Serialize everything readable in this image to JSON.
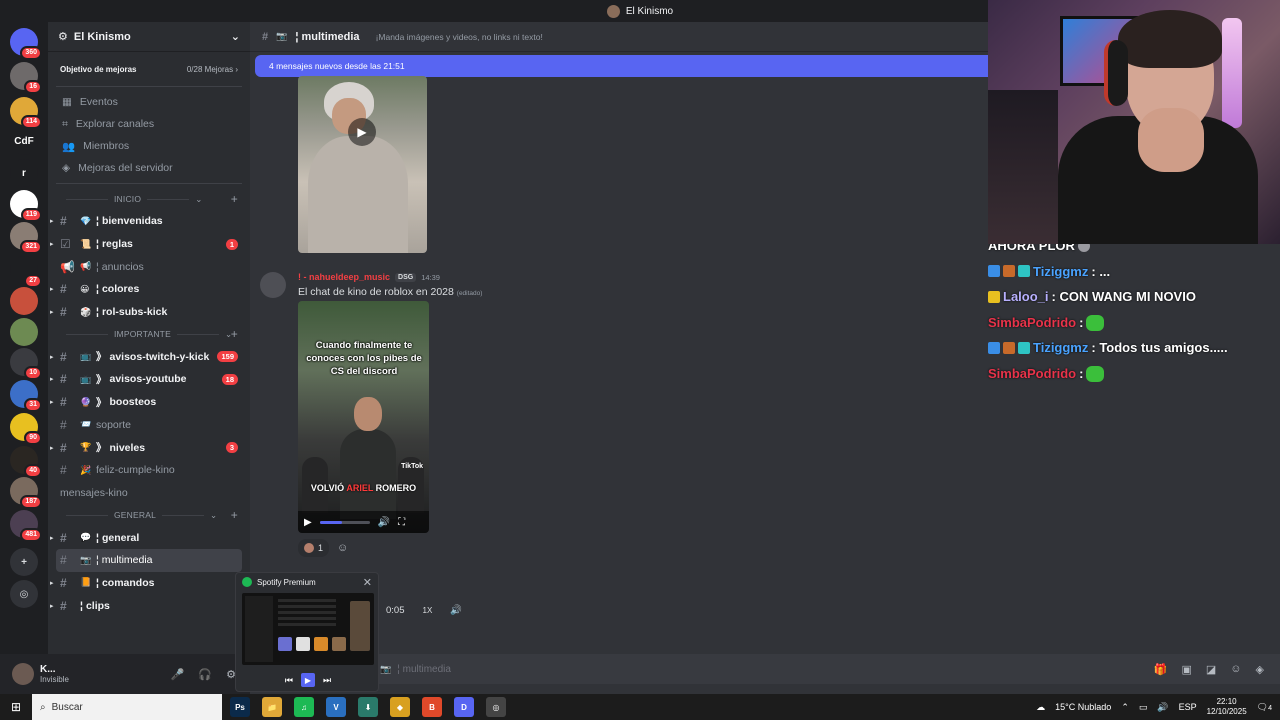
{
  "window": {
    "title": "El Kinismo"
  },
  "rail": {
    "servers": [
      {
        "label": "",
        "badge": "360",
        "color": "#5865f2"
      },
      {
        "label": "",
        "badge": "16",
        "color": "#6e6a6a"
      },
      {
        "label": "",
        "badge": "114",
        "color": "#e0a838"
      },
      {
        "label": "CdF",
        "badge": "",
        "color": "#1e1f22"
      },
      {
        "label": "r",
        "badge": "",
        "color": "#1e1f22"
      },
      {
        "label": "",
        "badge": "119",
        "color": "#ffffff"
      },
      {
        "label": "",
        "badge": "321",
        "color": "#8a7d74"
      },
      {
        "label": "",
        "badge": "27",
        "color": "#1e1f22"
      },
      {
        "label": "",
        "badge": "",
        "color": "#c8503c"
      },
      {
        "label": "",
        "badge": "",
        "color": "#6d8a52"
      },
      {
        "label": "",
        "badge": "10",
        "color": "#3a3b40"
      },
      {
        "label": "",
        "badge": "31",
        "color": "#3c6fc8"
      },
      {
        "label": "",
        "badge": "90",
        "color": "#e8c020"
      },
      {
        "label": "",
        "badge": "40",
        "color": "#2a2622"
      },
      {
        "label": "",
        "badge": "187",
        "color": "#7a6a5e"
      },
      {
        "label": "",
        "badge": "481",
        "color": "#4c3f52"
      }
    ]
  },
  "sidebar": {
    "server_name": "El Kinismo",
    "boost_goal_label": "Objetivo de mejoras",
    "boost_goal_value": "0/28 Mejoras",
    "nav": [
      {
        "label": "Eventos"
      },
      {
        "label": "Explorar canales"
      },
      {
        "label": "Miembros"
      },
      {
        "label": "Mejoras del servidor"
      }
    ],
    "categories": [
      {
        "name": "INICIO",
        "channels": [
          {
            "name": "bienvenidas",
            "emoji": "💎",
            "sep": "¦",
            "unread": true,
            "count": "",
            "symbol": "#"
          },
          {
            "name": "reglas",
            "emoji": "📜",
            "sep": "¦",
            "unread": true,
            "count": "1",
            "symbol": "☑"
          },
          {
            "name": "anuncios",
            "emoji": "📢",
            "sep": "¦",
            "unread": false,
            "count": "",
            "symbol": "📢"
          },
          {
            "name": "colores",
            "emoji": "😀",
            "sep": "¦",
            "unread": true,
            "count": "",
            "symbol": "#"
          },
          {
            "name": "rol-subs-kick",
            "emoji": "🎲",
            "sep": "¦",
            "unread": true,
            "count": "",
            "symbol": "#"
          }
        ]
      },
      {
        "name": "IMPORTANTE",
        "channels": [
          {
            "name": "avisos-twitch-y-kick",
            "emoji": "📺",
            "sep": "》",
            "unread": true,
            "count": "159",
            "symbol": "#"
          },
          {
            "name": "avisos-youtube",
            "emoji": "📺",
            "sep": "》",
            "unread": true,
            "count": "18",
            "symbol": "#"
          },
          {
            "name": "boosteos",
            "emoji": "🔮",
            "sep": "》",
            "unread": true,
            "count": "",
            "symbol": "#"
          },
          {
            "name": "soporte",
            "emoji": "📨",
            "sep": "",
            "unread": false,
            "count": "",
            "symbol": "#"
          },
          {
            "name": "niveles",
            "emoji": "🏆",
            "sep": "》",
            "unread": true,
            "count": "3",
            "symbol": "#"
          },
          {
            "name": "feliz-cumple-kino",
            "emoji": "🎉",
            "sep": "",
            "unread": false,
            "count": "",
            "symbol": "#"
          },
          {
            "name": "mensajes-kino",
            "emoji": "",
            "sep": "",
            "unread": false,
            "count": "",
            "symbol": ""
          }
        ]
      },
      {
        "name": "GENERAL",
        "channels": [
          {
            "name": "general",
            "emoji": "💬",
            "sep": "¦",
            "unread": true,
            "count": "",
            "symbol": "#"
          },
          {
            "name": "multimedia",
            "emoji": "📷",
            "sep": "¦",
            "unread": false,
            "count": "",
            "symbol": "#",
            "active": true
          },
          {
            "name": "comandos",
            "emoji": "📙",
            "sep": "¦",
            "unread": true,
            "count": "",
            "symbol": "#"
          },
          {
            "name": "clips",
            "emoji": "",
            "sep": "¦",
            "unread": true,
            "count": "",
            "symbol": "#"
          }
        ]
      }
    ]
  },
  "user": {
    "name": "K...",
    "status": "Invisible"
  },
  "chat": {
    "channel": "multimedia",
    "topic": "¡Manda imágenes y videos, no links ni texto!",
    "new_messages_banner": "4 mensajes nuevos desde las 21:51",
    "message": {
      "author": "! - nahueldeep_music",
      "tag": "DSG",
      "time": "14:39",
      "text": "El chat de kino de roblox en 2028",
      "edited": "(editado)"
    },
    "video_caption": "Cuando finalmente te conoces con los pibes de CS del discord",
    "video_bottom_pre": "VOLVIÓ ",
    "video_bottom_hl": "ARIEL",
    "video_bottom_post": " ROMERO",
    "video_watermark": "TikTok",
    "video_progress": 0.45,
    "reaction_count": "1",
    "audio_time": "0:05",
    "audio_speed": "1X",
    "composer_placeholder": "multimedia"
  },
  "spotify": {
    "title": "Spotify Premium"
  },
  "stream_chat": [
    {
      "user": "AHORA PLOR",
      "text": "",
      "color": "#ffffff",
      "badges": []
    },
    {
      "user": "Tiziggmz",
      "text": ": ...",
      "color": "#4aa3ff",
      "badges": [
        "#3a8ee6",
        "#c86a2a",
        "#2ec4c4"
      ]
    },
    {
      "user": "Laloo_i",
      "text": ": CON WANG MI NOVIO",
      "color": "#b8b0ff",
      "badges": [
        "#e8c020"
      ]
    },
    {
      "user": "SimbaPodrido",
      "text": ":",
      "color": "#e8334a",
      "badges": []
    },
    {
      "user": "Tiziggmz",
      "text": ": Todos tus amigos.....",
      "color": "#4aa3ff",
      "badges": [
        "#3a8ee6",
        "#c86a2a",
        "#2ec4c4"
      ]
    },
    {
      "user": "SimbaPodrido",
      "text": ":",
      "color": "#e8334a",
      "badges": []
    }
  ],
  "taskbar": {
    "search_placeholder": "Buscar",
    "weather": "15°C  Nublado",
    "lang": "ESP",
    "time": "22:10",
    "date": "12/10/2025",
    "notifications": "4",
    "apps": [
      {
        "label": "Ps",
        "color": "#0b2a4a"
      },
      {
        "label": "📁",
        "color": "#e0a838"
      },
      {
        "label": "♫",
        "color": "#1db954"
      },
      {
        "label": "V",
        "color": "#2a6fbf"
      },
      {
        "label": "⬇",
        "color": "#2a7a6a"
      },
      {
        "label": "◆",
        "color": "#d8a020"
      },
      {
        "label": "B",
        "color": "#e0492a"
      },
      {
        "label": "D",
        "color": "#5865f2"
      },
      {
        "label": "◎",
        "color": "#444444"
      }
    ]
  }
}
